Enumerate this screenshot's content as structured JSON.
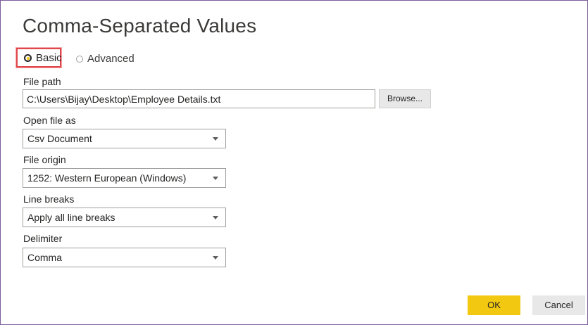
{
  "dialog": {
    "title": "Comma-Separated Values"
  },
  "mode": {
    "options": [
      {
        "label": "Basic",
        "selected": true
      },
      {
        "label": "Advanced",
        "selected": false
      }
    ],
    "highlight_color": "#e0474c"
  },
  "file_path": {
    "label": "File path",
    "value": "C:\\Users\\Bijay\\Desktop\\Employee Details.txt",
    "browse_label": "Browse..."
  },
  "open_file_as": {
    "label": "Open file as",
    "value": "Csv Document"
  },
  "file_origin": {
    "label": "File origin",
    "value": "1252: Western European (Windows)"
  },
  "line_breaks": {
    "label": "Line breaks",
    "value": "Apply all line breaks"
  },
  "delimiter": {
    "label": "Delimiter",
    "value": "Comma"
  },
  "buttons": {
    "ok_label": "OK",
    "cancel_label": "Cancel",
    "ok_color": "#f2c811"
  },
  "icons": {
    "dropdown": "chevron-down-icon",
    "radio_selected": "radio-checked-icon",
    "radio_unselected": "radio-unchecked-icon"
  }
}
